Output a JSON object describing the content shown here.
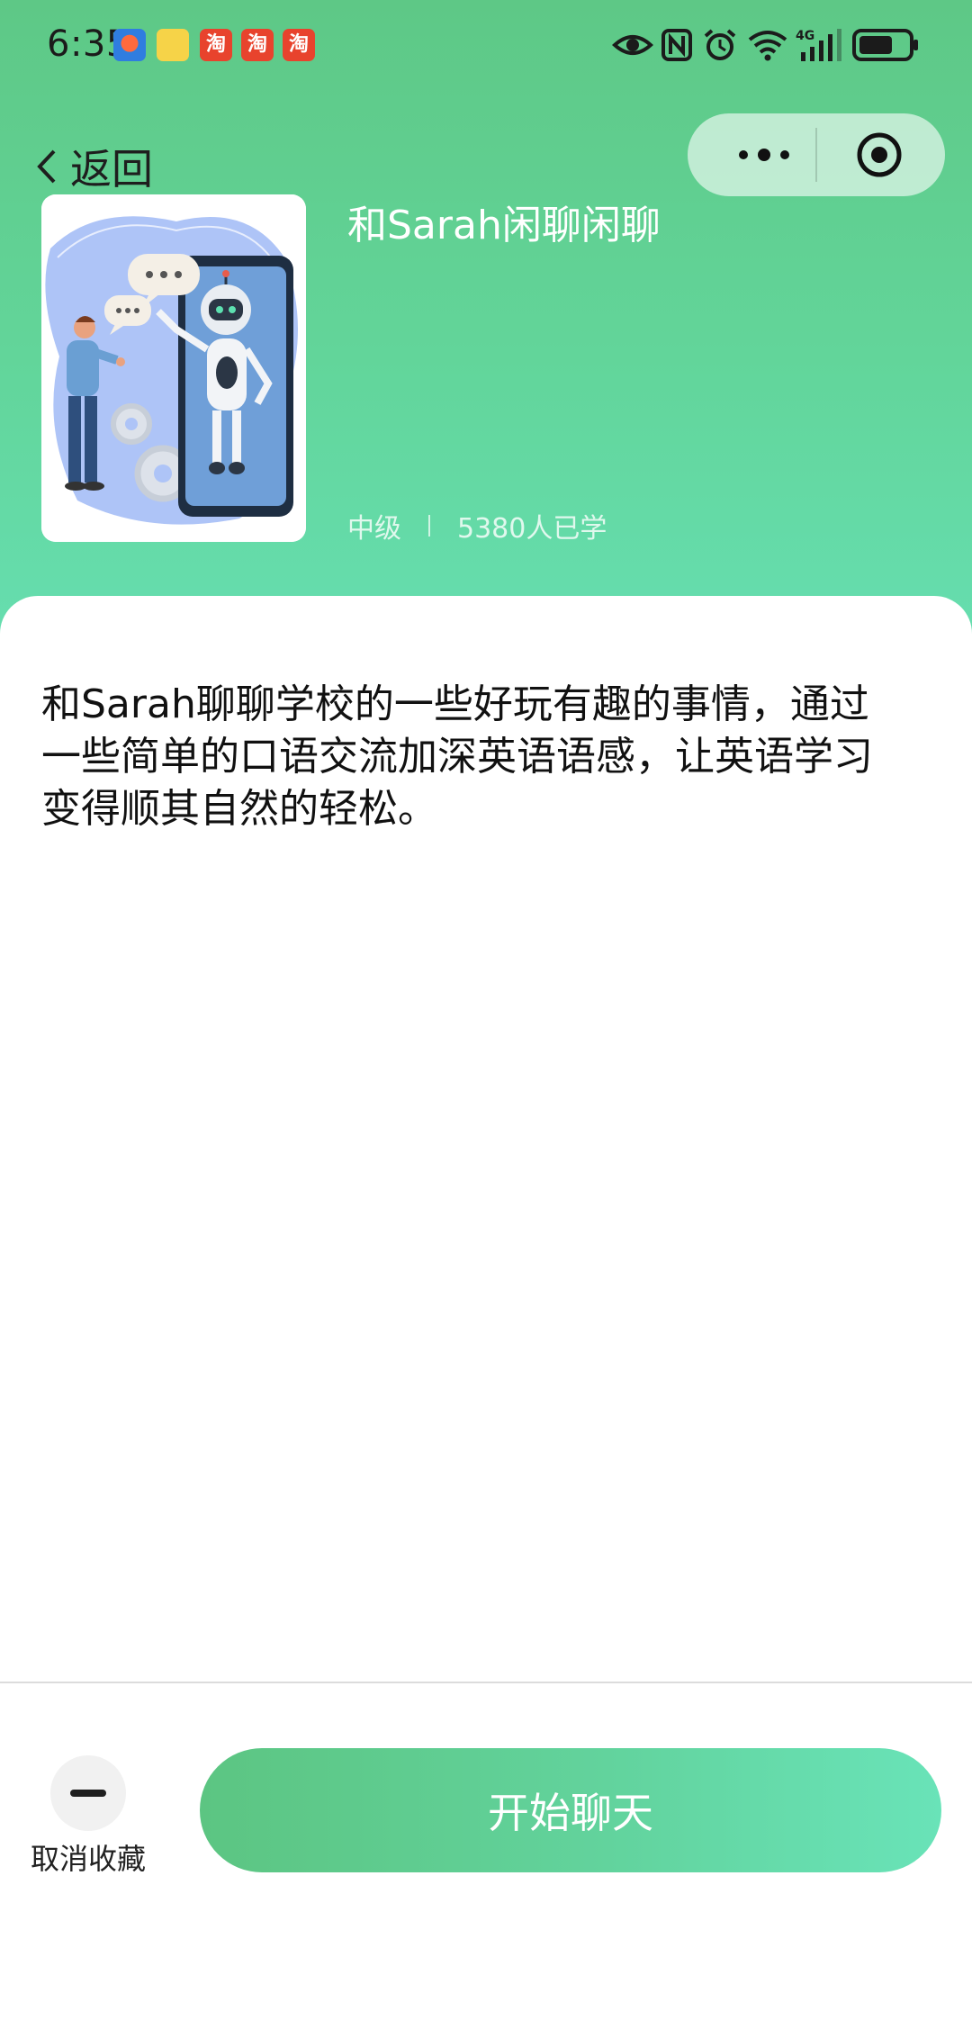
{
  "status_bar": {
    "time": "6:35",
    "notification_icons": [
      "app-icon-1",
      "app-icon-2",
      "taobao-icon",
      "taobao-icon",
      "taobao-icon"
    ],
    "taobao_glyph": "淘",
    "system_icons": [
      "eye-icon",
      "nfc-icon",
      "alarm-icon",
      "wifi-icon",
      "signal-4g-icon",
      "battery-icon"
    ],
    "network_label": "4G"
  },
  "nav": {
    "back_label": "返回",
    "capsule_icons": [
      "more-dots-icon",
      "target-icon"
    ]
  },
  "course": {
    "title": "和Sarah闲聊闲聊",
    "level": "中级",
    "learners": "5380人已学",
    "thumbnail": "robot-chat-illustration"
  },
  "content": {
    "description": "和Sarah聊聊学校的一些好玩有趣的事情，通过一些简单的口语交流加深英语语感，让英语学习变得顺其自然的轻松。"
  },
  "bottom": {
    "unfavorite_label": "取消收藏",
    "start_label": "开始聊天"
  },
  "colors": {
    "header_gradient_top": "#5ec886",
    "header_gradient_bottom": "#66deb0",
    "button_gradient_start": "#5cc582",
    "button_gradient_end": "#69e3b8"
  }
}
